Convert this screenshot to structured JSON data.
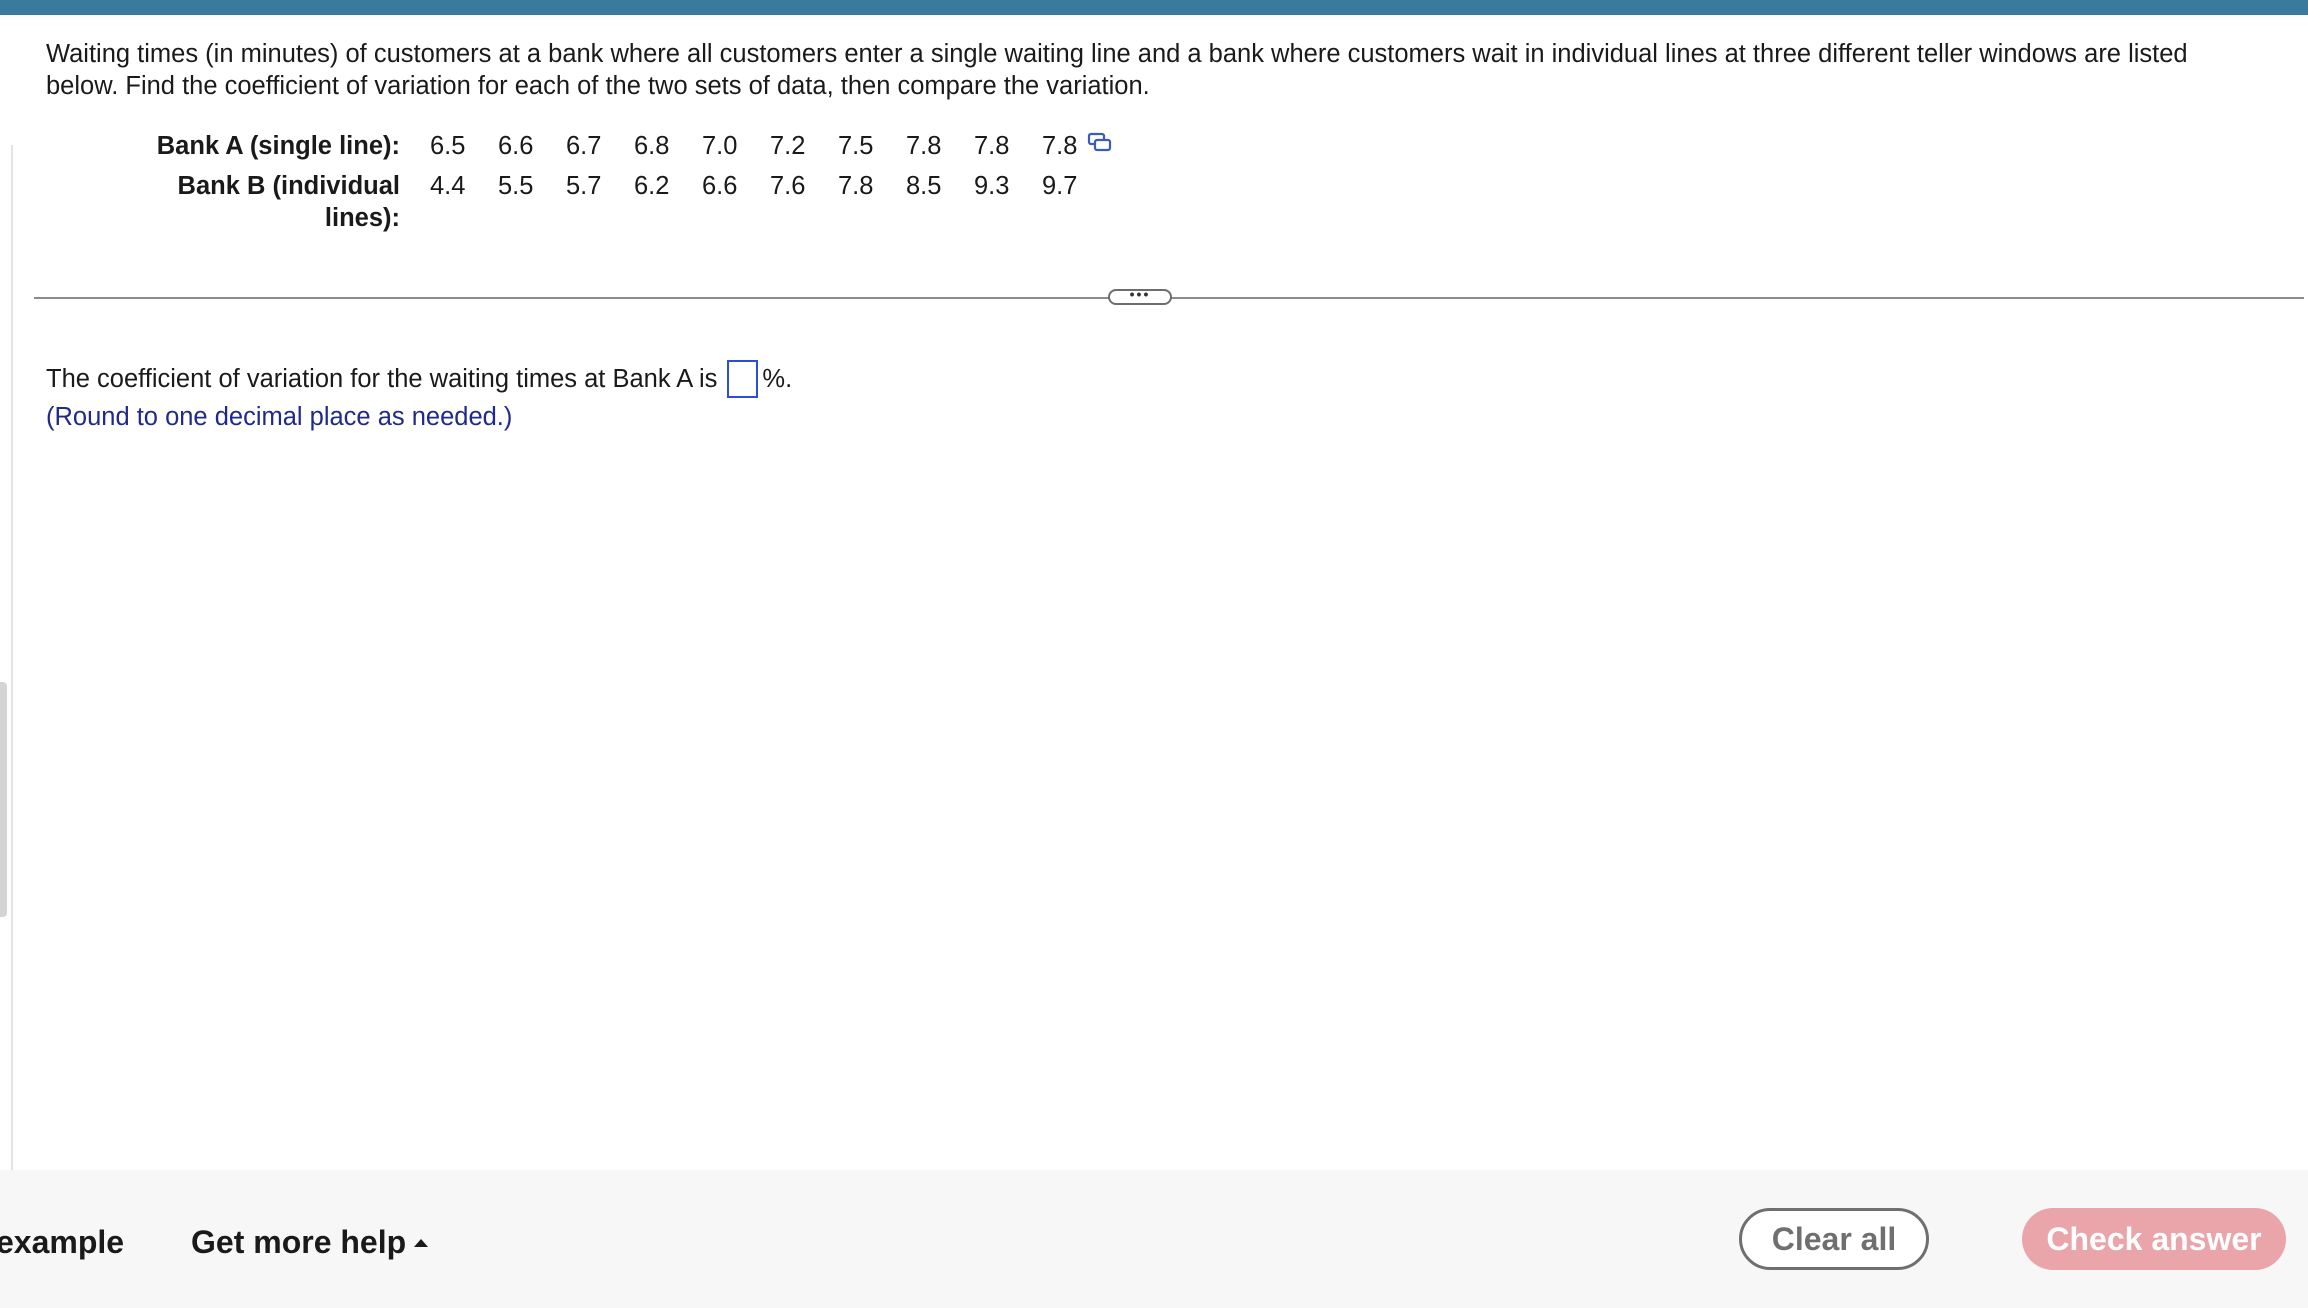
{
  "question": {
    "text": "Waiting times (in minutes) of customers at a bank where all customers enter a single waiting line and a bank where customers wait in individual lines at three different teller windows are listed below. Find the coefficient of variation for each of the two sets of data, then compare the variation."
  },
  "data_table": {
    "bank_a": {
      "label": "Bank A (single line):",
      "values": [
        "6.5",
        "6.6",
        "6.7",
        "6.8",
        "7.0",
        "7.2",
        "7.5",
        "7.8",
        "7.8",
        "7.8"
      ]
    },
    "bank_b": {
      "label": "Bank B (individual lines):",
      "values": [
        "4.4",
        "5.5",
        "5.7",
        "6.2",
        "6.6",
        "7.6",
        "7.8",
        "8.5",
        "9.3",
        "9.7"
      ]
    },
    "expand_icon": "expand-data-icon"
  },
  "more_button": {
    "label": "•••"
  },
  "answer": {
    "prompt": "The coefficient of variation for the waiting times at Bank A is",
    "value": "",
    "unit": "%.",
    "hint": "(Round to one decimal place as needed.)"
  },
  "footer": {
    "example_label": "example",
    "help_label": "Get more help",
    "clear_label": "Clear all",
    "check_label": "Check answer"
  },
  "colors": {
    "topbar": "#3a7a9c",
    "hint_text": "#1f2a8a",
    "input_border": "#2a4fd6",
    "check_button": "#eaa5ab"
  }
}
